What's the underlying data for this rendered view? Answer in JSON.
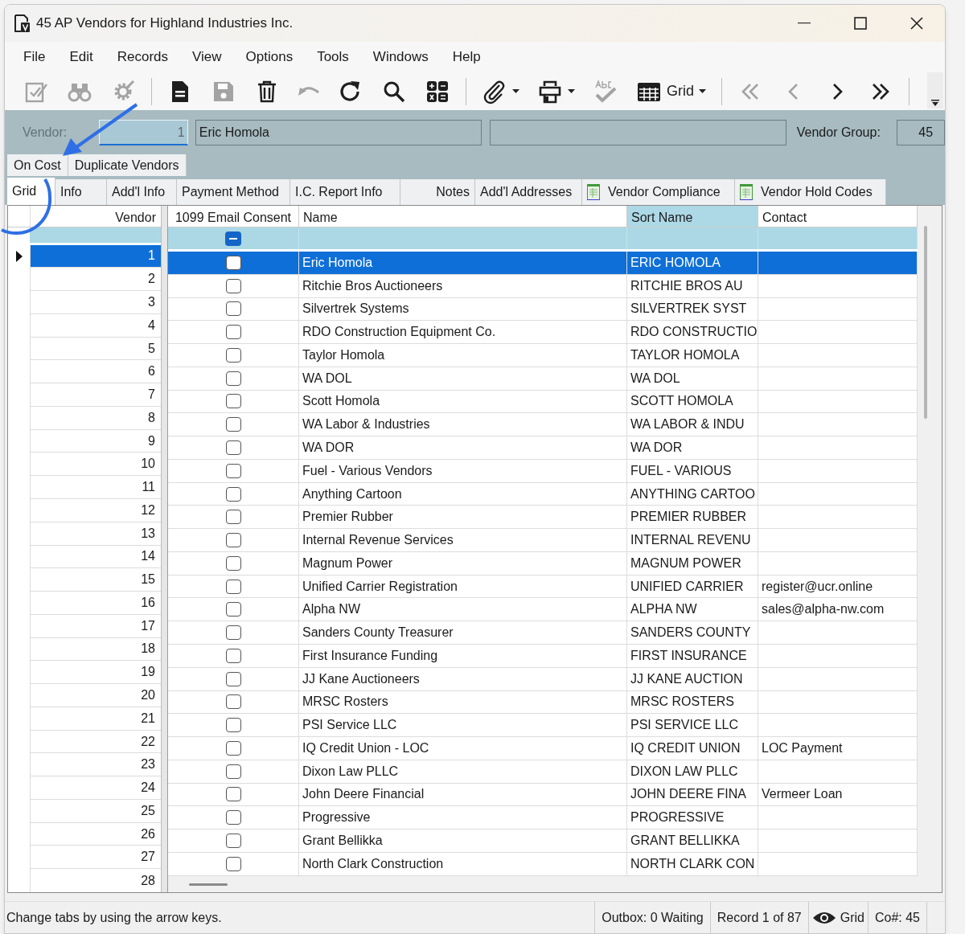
{
  "window": {
    "title": "45 AP Vendors for Highland Industries Inc."
  },
  "menu": [
    "File",
    "Edit",
    "Records",
    "View",
    "Options",
    "Tools",
    "Windows",
    "Help"
  ],
  "toolbar": {
    "buttons": [
      {
        "disabled": true
      },
      {
        "disabled": true
      },
      {
        "disabled": true
      },
      {
        "disabled": false
      },
      {
        "disabled": true
      },
      {
        "disabled": false
      },
      {
        "disabled": true
      },
      {
        "disabled": false
      },
      {
        "disabled": false
      },
      {
        "disabled": false
      },
      {
        "disabled": false
      },
      {
        "disabled": false
      },
      {
        "disabled": true
      },
      {
        "disabled": false
      },
      {
        "disabled": true
      },
      {
        "disabled": true
      },
      {
        "disabled": false
      },
      {
        "disabled": false
      }
    ],
    "view_label": "Grid"
  },
  "header": {
    "vendor_label": "Vendor:",
    "vendor_label_disabled": true,
    "vendor_number": "1",
    "vendor_name": "Eric Homola",
    "group_label": "Vendor Group:",
    "group_value": "45"
  },
  "tabs_back": [
    {
      "label": "On Cost",
      "selected": false
    },
    {
      "label": "Duplicate Vendors",
      "selected": false
    }
  ],
  "tabs": [
    {
      "label": "Grid",
      "selected": true,
      "kind": "plain"
    },
    {
      "label": "Info",
      "selected": false,
      "kind": "plain"
    },
    {
      "label": "Add'l Info",
      "selected": false,
      "kind": "plain"
    },
    {
      "label": "Payment Method",
      "selected": false,
      "kind": "plain"
    },
    {
      "label": "I.C. Report Info",
      "selected": false,
      "kind": "plain"
    },
    {
      "label": "Notes",
      "selected": false,
      "kind": "plain"
    },
    {
      "label": "Add'l Addresses",
      "selected": false,
      "kind": "plain"
    },
    {
      "label": "Vendor Compliance",
      "selected": false,
      "kind": "sheet"
    },
    {
      "label": "Vendor Hold Codes",
      "selected": false,
      "kind": "sheet"
    }
  ],
  "table": {
    "columns": [
      "Vendor",
      "1099 Email Consent",
      "Name",
      "Sort Name",
      "Contact"
    ],
    "filter_consent_indeterminate": true,
    "rows": [
      {
        "vendor": "1",
        "consent": false,
        "name": "Eric Homola",
        "sort_name": "ERIC HOMOLA",
        "contact": "",
        "selected": true
      },
      {
        "vendor": "2",
        "consent": false,
        "name": "Ritchie Bros Auctioneers",
        "sort_name": "RITCHIE BROS AU",
        "contact": "",
        "selected": false
      },
      {
        "vendor": "3",
        "consent": false,
        "name": "Silvertrek Systems",
        "sort_name": "SILVERTREK SYST",
        "contact": "",
        "selected": false
      },
      {
        "vendor": "4",
        "consent": false,
        "name": "RDO Construction Equipment Co.",
        "sort_name": "RDO CONSTRUCTIO",
        "contact": "",
        "selected": false
      },
      {
        "vendor": "5",
        "consent": false,
        "name": "Taylor Homola",
        "sort_name": "TAYLOR HOMOLA",
        "contact": "",
        "selected": false
      },
      {
        "vendor": "6",
        "consent": false,
        "name": "WA DOL",
        "sort_name": "WA DOL",
        "contact": "",
        "selected": false
      },
      {
        "vendor": "7",
        "consent": false,
        "name": "Scott Homola",
        "sort_name": "SCOTT HOMOLA",
        "contact": "",
        "selected": false
      },
      {
        "vendor": "8",
        "consent": false,
        "name": "WA Labor & Industries",
        "sort_name": "WA LABOR & INDU",
        "contact": "",
        "selected": false
      },
      {
        "vendor": "9",
        "consent": false,
        "name": "WA DOR",
        "sort_name": "WA DOR",
        "contact": "",
        "selected": false
      },
      {
        "vendor": "10",
        "consent": false,
        "name": "Fuel - Various Vendors",
        "sort_name": "FUEL - VARIOUS",
        "contact": "",
        "selected": false
      },
      {
        "vendor": "11",
        "consent": false,
        "name": "Anything Cartoon",
        "sort_name": "ANYTHING CARTOO",
        "contact": "",
        "selected": false
      },
      {
        "vendor": "12",
        "consent": false,
        "name": "Premier Rubber",
        "sort_name": "PREMIER RUBBER",
        "contact": "",
        "selected": false
      },
      {
        "vendor": "13",
        "consent": false,
        "name": "Internal Revenue Services",
        "sort_name": "INTERNAL REVENU",
        "contact": "",
        "selected": false
      },
      {
        "vendor": "14",
        "consent": false,
        "name": "Magnum Power",
        "sort_name": "MAGNUM POWER",
        "contact": "",
        "selected": false
      },
      {
        "vendor": "15",
        "consent": false,
        "name": "Unified Carrier Registration",
        "sort_name": "UNIFIED CARRIER",
        "contact": "register@ucr.online",
        "selected": false
      },
      {
        "vendor": "16",
        "consent": false,
        "name": "Alpha NW",
        "sort_name": "ALPHA NW",
        "contact": "sales@alpha-nw.com",
        "selected": false
      },
      {
        "vendor": "17",
        "consent": false,
        "name": "Sanders County Treasurer",
        "sort_name": "SANDERS COUNTY",
        "contact": "",
        "selected": false
      },
      {
        "vendor": "18",
        "consent": false,
        "name": "First Insurance Funding",
        "sort_name": "FIRST INSURANCE",
        "contact": "",
        "selected": false
      },
      {
        "vendor": "19",
        "consent": false,
        "name": "JJ Kane Auctioneers",
        "sort_name": "JJ KANE AUCTION",
        "contact": "",
        "selected": false
      },
      {
        "vendor": "20",
        "consent": false,
        "name": "MRSC Rosters",
        "sort_name": "MRSC ROSTERS",
        "contact": "",
        "selected": false
      },
      {
        "vendor": "21",
        "consent": false,
        "name": "PSI Service LLC",
        "sort_name": "PSI SERVICE LLC",
        "contact": "",
        "selected": false
      },
      {
        "vendor": "22",
        "consent": false,
        "name": "IQ Credit Union - LOC",
        "sort_name": "IQ CREDIT UNION",
        "contact": "LOC Payment",
        "selected": false
      },
      {
        "vendor": "23",
        "consent": false,
        "name": "Dixon Law PLLC",
        "sort_name": "DIXON LAW PLLC",
        "contact": "",
        "selected": false
      },
      {
        "vendor": "24",
        "consent": false,
        "name": "John Deere Financial",
        "sort_name": "JOHN DEERE FINA",
        "contact": "Vermeer Loan",
        "selected": false
      },
      {
        "vendor": "25",
        "consent": false,
        "name": "Progressive",
        "sort_name": "PROGRESSIVE",
        "contact": "",
        "selected": false
      },
      {
        "vendor": "26",
        "consent": false,
        "name": "Grant Bellikka",
        "sort_name": "GRANT BELLIKKA",
        "contact": "",
        "selected": false
      },
      {
        "vendor": "27",
        "consent": false,
        "name": "North Clark Construction",
        "sort_name": "NORTH CLARK CON",
        "contact": "",
        "selected": false
      }
    ],
    "extra_vendor_rows": [
      "28"
    ]
  },
  "status_bar": {
    "message": "Change tabs by using the arrow keys.",
    "outbox": "Outbox: 0 Waiting",
    "record": "Record 1 of 87",
    "view": "Grid",
    "company": "Co#: 45"
  }
}
